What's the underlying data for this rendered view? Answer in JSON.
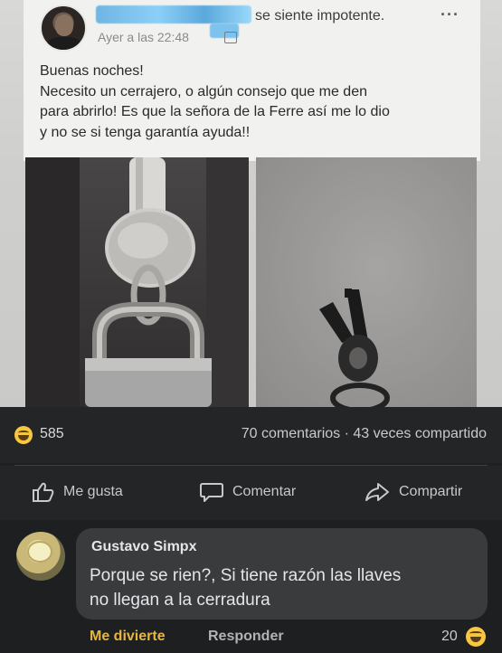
{
  "post": {
    "status": "se siente impotente.",
    "timestamp": "Ayer a las 22:48",
    "more_icon": "more-dots-icon",
    "body_lines": [
      "Buenas noches!",
      "Necesito un cerrajero,  o algún consejo que me den",
      "para abrirlo! Es que la señora de la Ferre así me lo dio",
      "y no se si tenga garantía ayuda!!"
    ]
  },
  "photos": {
    "left": "padlock-with-key-photo",
    "right": "keys-on-ground-photo"
  },
  "stats": {
    "reaction_icon": "haha-emoji-icon",
    "reaction_count": "585",
    "meta": "70 comentarios · 43 veces compartido"
  },
  "actions": {
    "like": "Me gusta",
    "comment": "Comentar",
    "share": "Compartir"
  },
  "comment": {
    "author": "Gustavo Simpx",
    "text_lines": [
      "Porque se rien?, Si tiene razón las llaves",
      "no llegan a la cerradura"
    ],
    "reaction_label": "Me divierte",
    "reply_label": "Responder",
    "reaction_count": "20"
  },
  "colors": {
    "accent_haha": "#e8b63c",
    "dark_bg": "#242526",
    "bubble_bg": "#3a3b3c"
  }
}
